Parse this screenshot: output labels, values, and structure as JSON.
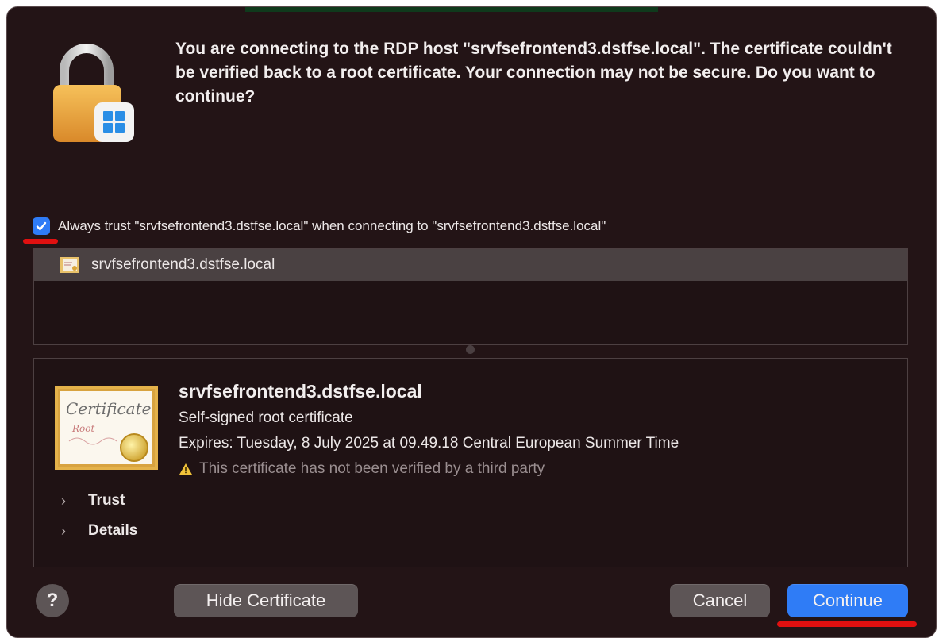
{
  "dialog": {
    "message": "You are connecting to the RDP host \"srvfsefrontend3.dstfse.local\". The certificate couldn't be verified back to a root certificate. Your connection may not be secure. Do you want to continue?",
    "always_trust_label": "Always trust \"srvfsefrontend3.dstfse.local\" when connecting to \"srvfsefrontend3.dstfse.local\"",
    "always_trust_checked": true
  },
  "cert_list": {
    "items": [
      {
        "label": "srvfsefrontend3.dstfse.local",
        "selected": true
      }
    ]
  },
  "details": {
    "name": "srvfsefrontend3.dstfse.local",
    "type": "Self-signed root certificate",
    "expires": "Expires: Tuesday, 8 July 2025 at 09.49.18 Central European Summer Time",
    "warning": "This certificate has not been verified by a third party",
    "sections": [
      "Trust",
      "Details"
    ]
  },
  "buttons": {
    "help": "?",
    "hide_certificate": "Hide Certificate",
    "cancel": "Cancel",
    "continue": "Continue"
  },
  "colors": {
    "dialog_bg": "#231416",
    "accent": "#2f7cf6",
    "annotation": "#e01010"
  },
  "icons": {
    "lock": "lock-with-windows-badge-icon",
    "certificate": "certificate-icon",
    "warning": "warning-triangle-icon",
    "chevron": "chevron-right-icon",
    "checkmark": "checkmark-icon"
  }
}
